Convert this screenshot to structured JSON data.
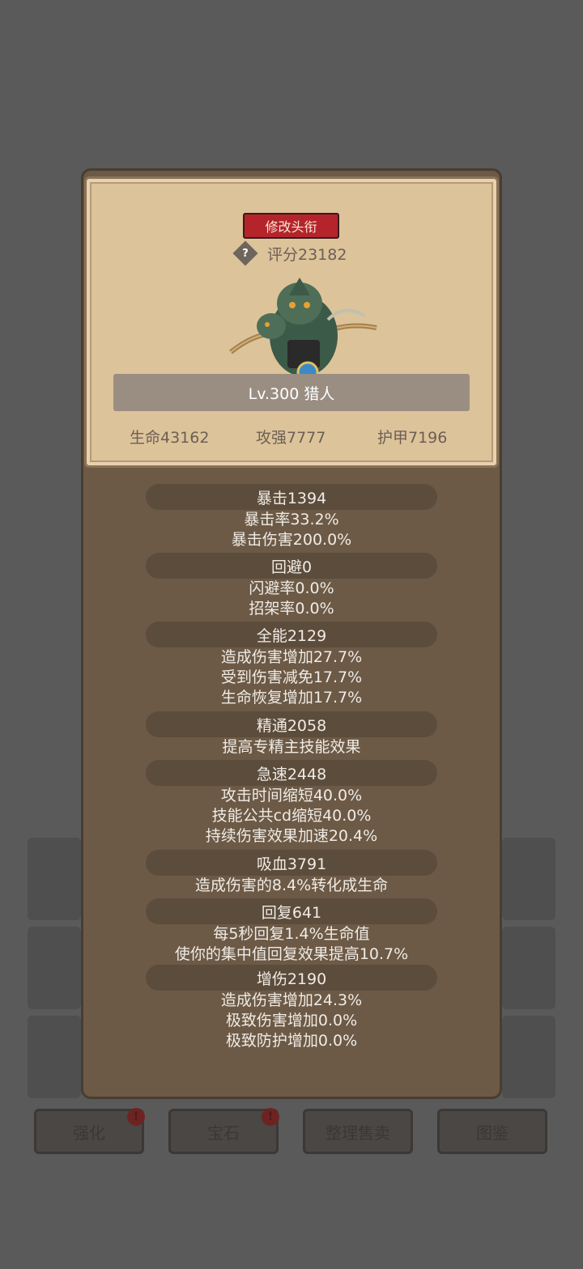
{
  "header": {
    "title_button": "修改头衔",
    "help_icon": "?",
    "score": "评分23182",
    "name": "Lv.300 猎人",
    "base_stats": [
      "生命43162",
      "攻强7777",
      "护甲7196"
    ]
  },
  "sections": [
    {
      "title": "暴击1394",
      "lines": [
        "暴击率33.2%",
        "暴击伤害200.0%"
      ]
    },
    {
      "title": "回避0",
      "lines": [
        "闪避率0.0%",
        "招架率0.0%"
      ]
    },
    {
      "title": "全能2129",
      "lines": [
        "造成伤害增加27.7%",
        "受到伤害减免17.7%",
        "生命恢复增加17.7%"
      ]
    },
    {
      "title": "精通2058",
      "lines": [
        "提高专精主技能效果"
      ]
    },
    {
      "title": "急速2448",
      "lines": [
        "攻击时间缩短40.0%",
        "技能公共cd缩短40.0%",
        "持续伤害效果加速20.4%"
      ]
    },
    {
      "title": "吸血3791",
      "lines": [
        "造成伤害的8.4%转化成生命"
      ]
    },
    {
      "title": "回复641",
      "lines": [
        "每5秒回复1.4%生命值",
        "使你的集中值回复效果提高10.7%"
      ]
    },
    {
      "title": "增伤2190",
      "lines": [
        "造成伤害增加24.3%",
        "极致伤害增加0.0%",
        "极致防护增加0.0%"
      ]
    }
  ],
  "bottom_buttons": [
    {
      "label": "强化",
      "badge": "!"
    },
    {
      "label": "宝石",
      "badge": "!"
    },
    {
      "label": "整理售卖"
    },
    {
      "label": "图鉴"
    }
  ]
}
